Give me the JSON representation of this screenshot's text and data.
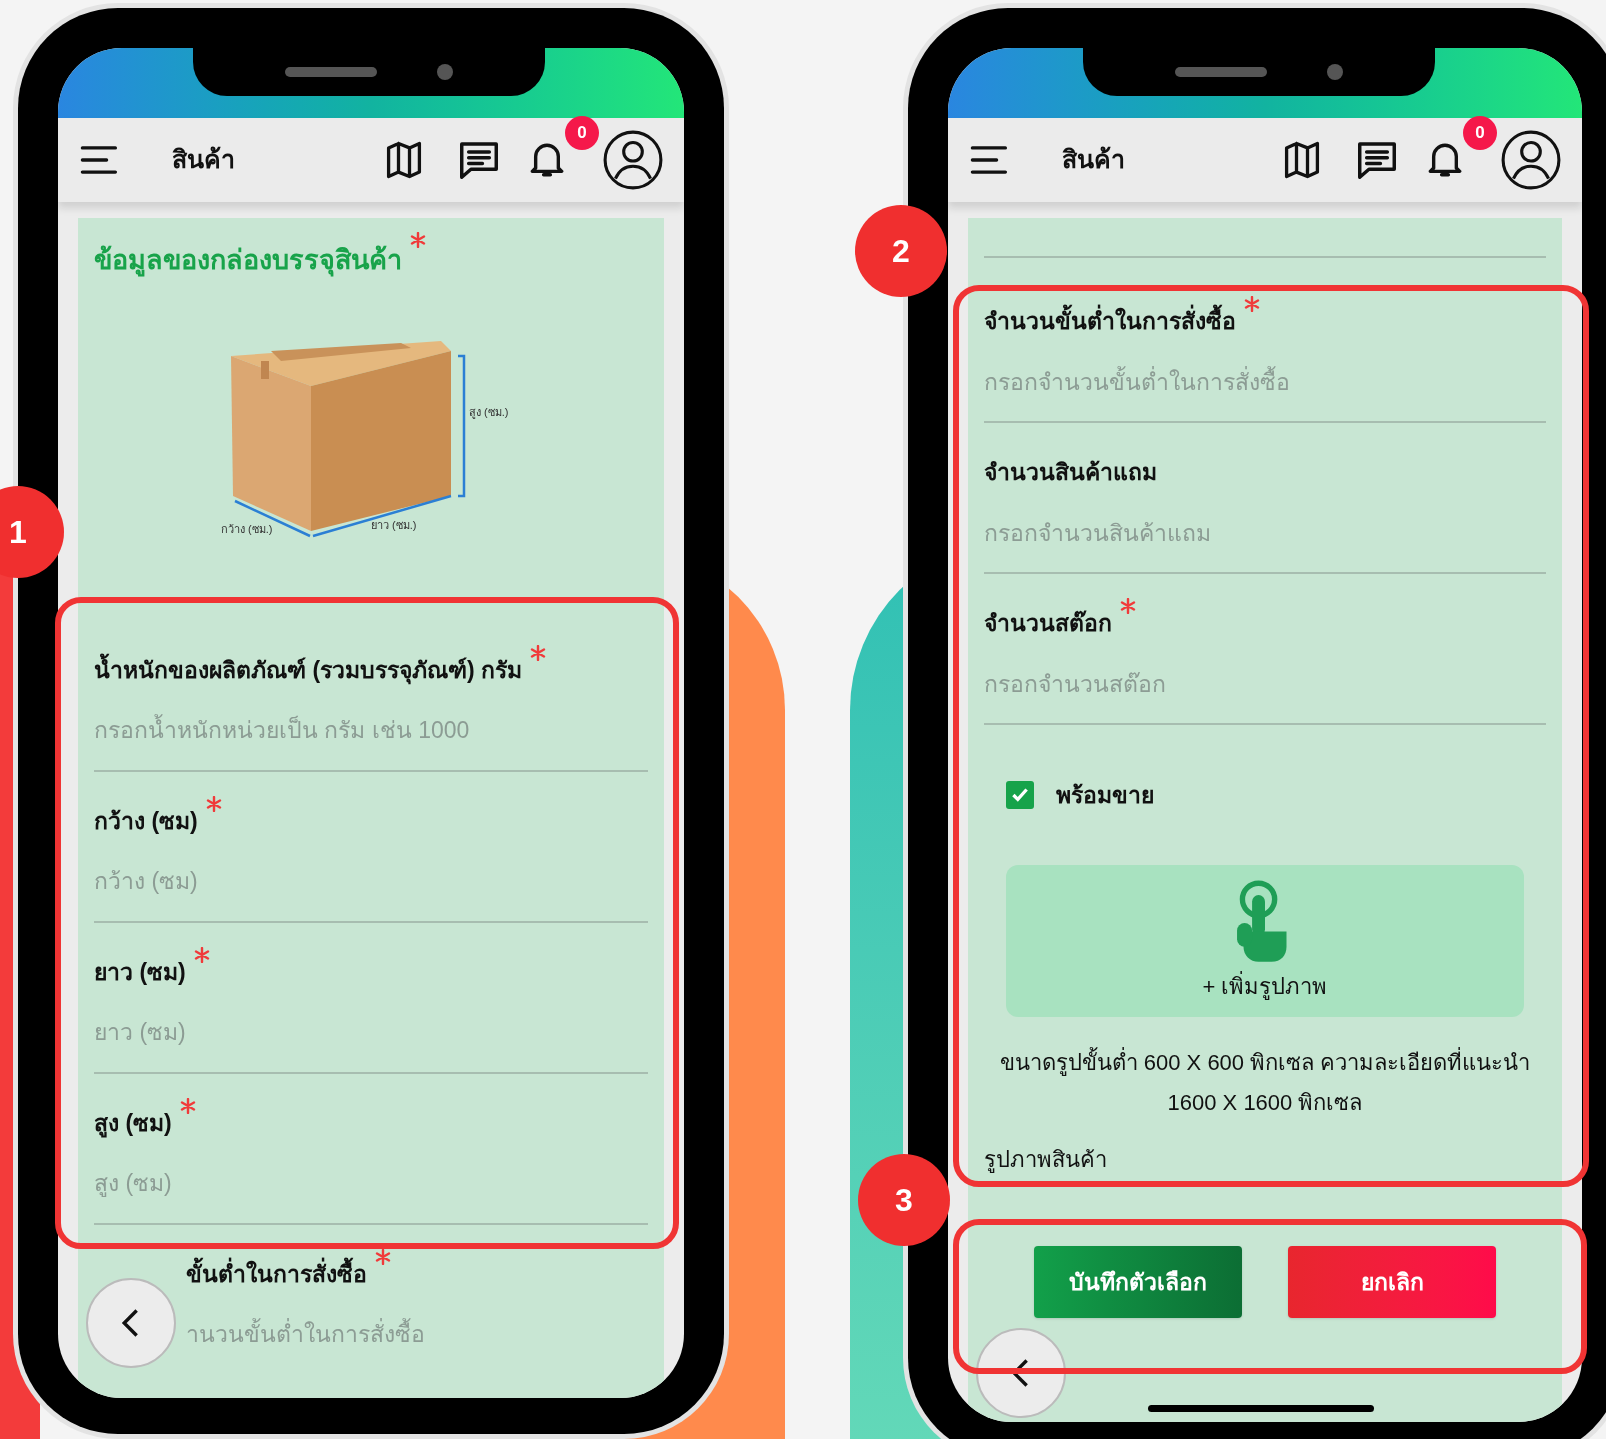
{
  "phones": [
    {
      "header": {
        "title": "สินค้า",
        "notification_count": "0"
      },
      "sections": [
        {
          "kind": "heading",
          "text": "ข้อมูลของกล่องบรรจุสินค้า",
          "required": true
        },
        {
          "kind": "box-diagram",
          "labels": {
            "height": "สูง (ซม.)",
            "width": "กว้าง (ซม.)",
            "length": "ยาว (ซม.)"
          }
        },
        {
          "kind": "field",
          "label": "น้ำหนักของผลิตภัณฑ์ (รวมบรรจุภัณฑ์) กรัม",
          "required": true,
          "placeholder": "กรอกน้ำหนักหน่วยเป็น กรัม เช่น 1000"
        },
        {
          "kind": "field",
          "label": "กว้าง (ซม)",
          "required": true,
          "placeholder": "กว้าง (ซม)"
        },
        {
          "kind": "field",
          "label": "ยาว (ซม)",
          "required": true,
          "placeholder": "ยาว (ซม)"
        },
        {
          "kind": "field",
          "label": "สูง (ซม)",
          "required": true,
          "placeholder": "สูง (ซม)"
        },
        {
          "kind": "partial-field",
          "label": "ขั้นต่ำในการสั่งซื้อ",
          "required": true,
          "placeholder": "านวนขั้นต่ำในการสั่งซื้อ"
        }
      ]
    },
    {
      "header": {
        "title": "สินค้า",
        "notification_count": "0"
      },
      "sections": [
        {
          "kind": "divider"
        },
        {
          "kind": "field",
          "label": "จำนวนขั้นต่ำในการสั่งซื้อ",
          "required": true,
          "placeholder": "กรอกจำนวนขั้นต่ำในการสั่งซื้อ"
        },
        {
          "kind": "field",
          "label": "จำนวนสินค้าแถม",
          "required": false,
          "placeholder": "กรอกจำนวนสินค้าแถม"
        },
        {
          "kind": "field",
          "label": "จำนวนสต๊อก",
          "required": true,
          "placeholder": "กรอกจำนวนสต๊อก"
        },
        {
          "kind": "checkbox",
          "label": "พร้อมขาย",
          "checked": true
        },
        {
          "kind": "upload",
          "label": "+ เพิ่มรูปภาพ"
        },
        {
          "kind": "note",
          "text": "ขนาดรูปขั้นต่ำ 600 X 600 พิกเซล ความละเอียดที่แนะนำ 1600 X 1600 พิกเซล"
        },
        {
          "kind": "caption",
          "text": "รูปภาพสินค้า"
        },
        {
          "kind": "actions",
          "buttons": [
            {
              "label": "บันทึกตัวเลือก",
              "kind": "save"
            },
            {
              "label": "ยกเลิก",
              "kind": "cancel"
            }
          ]
        }
      ]
    }
  ],
  "callouts": [
    {
      "number": "1"
    },
    {
      "number": "2"
    },
    {
      "number": "3"
    }
  ]
}
